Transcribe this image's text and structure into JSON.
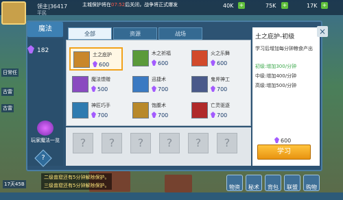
{
  "hud": {
    "player_name": "领主|36417",
    "player_sub": "平民",
    "marquee_pre": "主城保护将在",
    "marquee_time": "07:52",
    "marquee_post": "后关闭，战争将正式爆发",
    "res1": "40K",
    "res2": "75K",
    "res3": "17K",
    "left_labels": [
      "日常任",
      "古雷",
      "古雷"
    ],
    "notices": [
      "二级兽窟还有5分钟解除保护。",
      "三级兽窟还有5分钟解除保护。"
    ],
    "bottom_left": "17天45B",
    "bottom_buttons": [
      "物资",
      "秘术",
      "背包",
      "联盟",
      "购物"
    ]
  },
  "window": {
    "title": "魔法",
    "mana": "182",
    "player_magic_label": "玩家魔法一览",
    "help": "?",
    "close": "×",
    "tabs": [
      "全部",
      "资源",
      "战场"
    ],
    "active_tab": 0,
    "spells": [
      {
        "name": "土之庇护",
        "cost": "600",
        "icon_color": "#c9872a",
        "selected": true
      },
      {
        "name": "木之祈福",
        "cost": "600",
        "icon_color": "#5a9a3a",
        "selected": false
      },
      {
        "name": "火之乐舞",
        "cost": "600",
        "icon_color": "#d24a2b",
        "selected": false
      },
      {
        "name": "魔法馈赠",
        "cost": "500",
        "icon_color": "#8a4ac0",
        "selected": false
      },
      {
        "name": "迅捷术",
        "cost": "700",
        "icon_color": "#3a7ac2",
        "selected": false
      },
      {
        "name": "鬼斧神工",
        "cost": "700",
        "icon_color": "#4a5a8a",
        "selected": false
      },
      {
        "name": "神匠巧手",
        "cost": "700",
        "icon_color": "#2f7bb0",
        "selected": false
      },
      {
        "name": "饱腹术",
        "cost": "700",
        "icon_color": "#b8892a",
        "selected": false
      },
      {
        "name": "亡灵驱逐",
        "cost": "700",
        "icon_color": "#b02a2a",
        "selected": false
      }
    ],
    "locked_slots": [
      "?",
      "?",
      "?",
      "?",
      "?",
      "?"
    ],
    "detail": {
      "title": "土之庇护-初级",
      "desc": "学习后增加每分钟粮食产出",
      "levels": [
        {
          "text": "初级:增加300/分钟",
          "color": "#3aa84a"
        },
        {
          "text": "中级:增加400/分钟",
          "color": "#333333"
        },
        {
          "text": "高级:增加500/分钟",
          "color": "#333333"
        }
      ],
      "cost": "600",
      "learn": "学习"
    }
  }
}
